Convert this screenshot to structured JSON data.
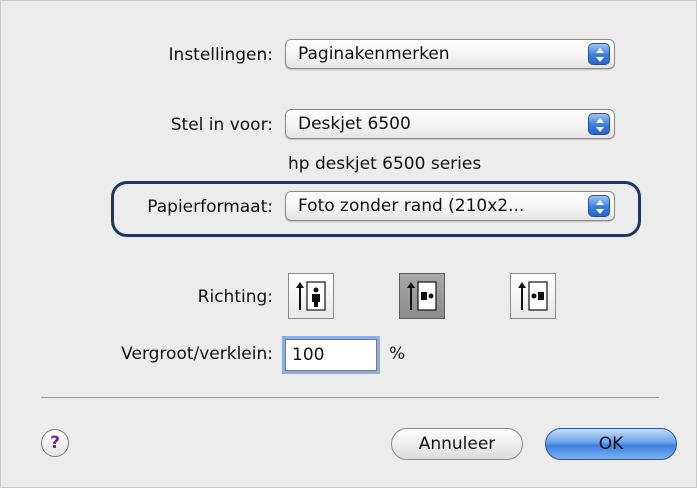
{
  "dialog": {
    "settings": {
      "label": "Instellingen:",
      "value": "Paginakenmerken"
    },
    "format_for": {
      "label": "Stel in voor:",
      "value": "Deskjet 6500",
      "description": "hp deskjet 6500 series"
    },
    "paper_size": {
      "label": "Papierformaat:",
      "value": "Foto zonder rand (210x2..."
    },
    "orientation": {
      "label": "Richting:",
      "options": [
        "portrait",
        "landscape",
        "reverse-landscape"
      ],
      "selected": "landscape"
    },
    "scale": {
      "label": "Vergroot/verklein:",
      "value": "100",
      "unit": "%"
    },
    "buttons": {
      "help": "?",
      "cancel": "Annuleer",
      "ok": "OK"
    }
  },
  "colors": {
    "highlight": "#1e3566",
    "accent_blue": "#3e7fe0",
    "help_icon": "#6a2aa5"
  },
  "icons": [
    "popup-arrows-icon",
    "portrait-icon",
    "landscape-icon",
    "reverse-landscape-icon",
    "help-icon"
  ]
}
